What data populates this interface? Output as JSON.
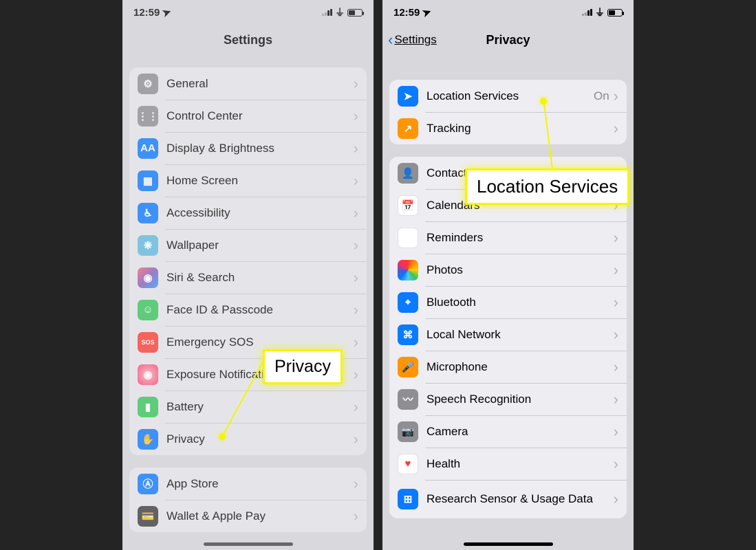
{
  "status": {
    "time": "12:59",
    "loc_arrow": "➤"
  },
  "left": {
    "title": "Settings",
    "groups": [
      {
        "rows": [
          {
            "icon": "gear-icon",
            "color": "c-gear",
            "glyph": "⚙︎",
            "label": "General"
          },
          {
            "icon": "control-center-icon",
            "color": "c-gray",
            "glyph": "⋮⋮",
            "label": "Control Center"
          },
          {
            "icon": "display-icon",
            "color": "c-blue",
            "glyph": "AA",
            "label": "Display & Brightness"
          },
          {
            "icon": "home-screen-icon",
            "color": "c-blue",
            "glyph": "▦",
            "label": "Home Screen"
          },
          {
            "icon": "accessibility-icon",
            "color": "c-blue",
            "glyph": "♿︎",
            "label": "Accessibility"
          },
          {
            "icon": "wallpaper-icon",
            "color": "c-teal",
            "glyph": "❋",
            "label": "Wallpaper"
          },
          {
            "icon": "siri-icon",
            "color": "c-grad",
            "glyph": "◉",
            "label": "Siri & Search"
          },
          {
            "icon": "faceid-icon",
            "color": "c-green",
            "glyph": "☺︎",
            "label": "Face ID & Passcode"
          },
          {
            "icon": "sos-icon",
            "color": "c-red",
            "glyph": "SOS",
            "label": "Emergency SOS"
          },
          {
            "icon": "exposure-icon",
            "color": "c-pink",
            "glyph": "◉",
            "label": "Exposure Notifications"
          },
          {
            "icon": "battery-icon",
            "color": "c-green",
            "glyph": "▮",
            "label": "Battery"
          },
          {
            "icon": "privacy-icon",
            "color": "c-blue",
            "glyph": "✋",
            "label": "Privacy"
          }
        ]
      },
      {
        "rows": [
          {
            "icon": "appstore-icon",
            "color": "c-blue",
            "glyph": "Ⓐ",
            "label": "App Store"
          },
          {
            "icon": "wallet-icon",
            "color": "c-dark",
            "glyph": "💳",
            "label": "Wallet & Apple Pay"
          }
        ]
      }
    ]
  },
  "right": {
    "title": "Privacy",
    "back": "Settings",
    "groups": [
      {
        "rows": [
          {
            "icon": "location-icon",
            "color": "c-blue",
            "glyph": "➤",
            "label": "Location Services",
            "value": "On"
          },
          {
            "icon": "tracking-icon",
            "color": "c-orange",
            "glyph": "↗",
            "label": "Tracking"
          }
        ]
      },
      {
        "rows": [
          {
            "icon": "contacts-icon",
            "color": "c-gray",
            "glyph": "👤",
            "label": "Contacts"
          },
          {
            "icon": "calendars-icon",
            "color": "c-rdots",
            "glyph": "📅",
            "label": "Calendars"
          },
          {
            "icon": "reminders-icon",
            "color": "c-rdots",
            "glyph": "⋮",
            "label": "Reminders"
          },
          {
            "icon": "photos-icon",
            "color": "c-multi",
            "glyph": "",
            "label": "Photos"
          },
          {
            "icon": "bluetooth-icon",
            "color": "c-blue",
            "glyph": "⌖",
            "label": "Bluetooth"
          },
          {
            "icon": "localnet-icon",
            "color": "c-blue",
            "glyph": "⌘",
            "label": "Local Network"
          },
          {
            "icon": "microphone-icon",
            "color": "c-orange",
            "glyph": "🎤",
            "label": "Microphone"
          },
          {
            "icon": "speech-icon",
            "color": "c-gray",
            "glyph": "〰",
            "label": "Speech Recognition"
          },
          {
            "icon": "camera-icon",
            "color": "c-gray",
            "glyph": "📷",
            "label": "Camera"
          },
          {
            "icon": "health-icon",
            "color": "c-white",
            "glyph": "♥︎",
            "label": "Health"
          },
          {
            "icon": "research-icon",
            "color": "c-blue",
            "glyph": "⊞",
            "label": "Research Sensor & Usage Data",
            "tall": true
          }
        ]
      }
    ]
  },
  "callouts": {
    "privacy": "Privacy",
    "location": "Location Services"
  }
}
